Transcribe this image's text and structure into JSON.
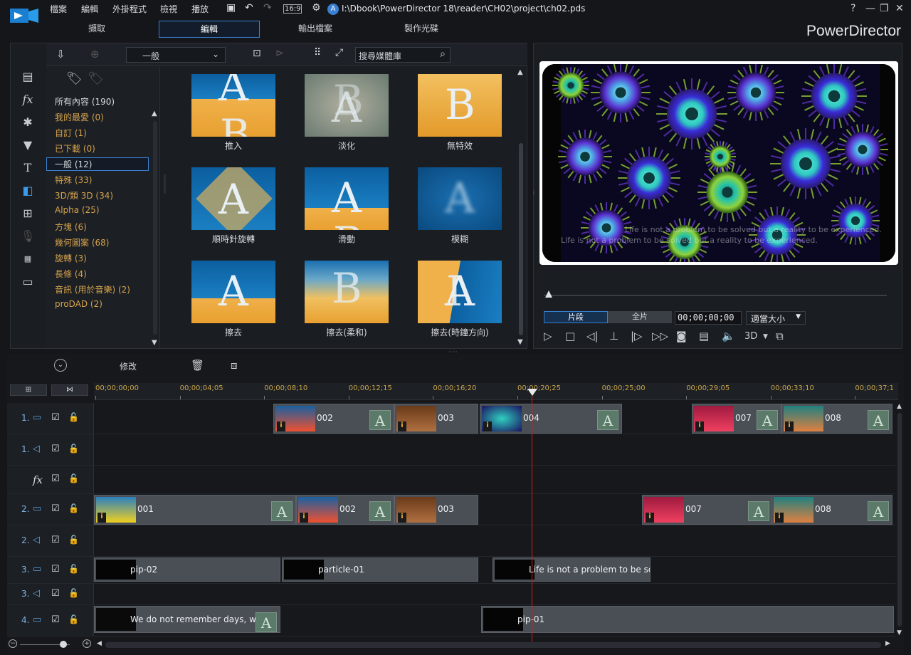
{
  "menu": [
    "檔案",
    "編輯",
    "外掛程式",
    "檢視",
    "播放"
  ],
  "aspect": "16:9",
  "file_path": "I:\\Dbook\\PowerDirector 18\\reader\\CH02\\project\\ch02.pds",
  "window_controls": {
    "help": "?"
  },
  "modes": [
    "擷取",
    "編輯",
    "輸出檔案",
    "製作光碟"
  ],
  "brand": "PowerDirector",
  "library": {
    "dropdown": "一般",
    "search_placeholder": "搜尋媒體庫",
    "categories": [
      {
        "label": "所有內容 (190)",
        "color": "white"
      },
      {
        "label": "我的最愛 (0)"
      },
      {
        "label": "自訂 (1)"
      },
      {
        "label": "已下載 (0)"
      },
      {
        "label": "一般 (12)",
        "selected": true
      },
      {
        "label": "特殊 (33)"
      },
      {
        "label": "3D/類 3D (34)"
      },
      {
        "label": "Alpha (25)"
      },
      {
        "label": "方塊 (6)"
      },
      {
        "label": "幾何圖案 (68)"
      },
      {
        "label": "旋轉 (3)"
      },
      {
        "label": "長條 (4)"
      },
      {
        "label": "音訊 (用於音樂) (2)"
      },
      {
        "label": "proDAD (2)"
      }
    ],
    "transitions": [
      "推入",
      "淡化",
      "無特效",
      "順時針旋轉",
      "滑動",
      "模糊",
      "擦去",
      "擦去(柔和)",
      "擦去(時鐘方向)"
    ]
  },
  "preview": {
    "subtitle_1": "Life is not a problem to be solved but a reality to be experienced.",
    "subtitle_2": "Life is not a problem to be solved but a reality to be experienced.",
    "tab_clip": "片段",
    "tab_movie": "全片",
    "timecode": "00;00;00;00",
    "fit": "適當大小",
    "mode_3d": "3D"
  },
  "timeline": {
    "modify_label": "修改",
    "ticks": [
      "00;00;00;00",
      "00;00;04;05",
      "00;00;08;10",
      "00;00;12;15",
      "00;00;16;20",
      "00;00;20;25",
      "00;00;25;00",
      "00;00;29;05",
      "00;00;33;10",
      "00;00;37;1"
    ],
    "tracks": [
      {
        "num": "1."
      },
      {
        "num": "1."
      },
      {
        "num": ""
      },
      {
        "num": "2."
      },
      {
        "num": "2."
      },
      {
        "num": "3."
      },
      {
        "num": "3."
      },
      {
        "num": "4."
      }
    ],
    "clips": {
      "t1": [
        "002",
        "003",
        "004",
        "007",
        "008"
      ],
      "t2": [
        "001",
        "002",
        "003",
        "007",
        "008"
      ],
      "t3": [
        "pip-02",
        "particle-01",
        "Life is not a problem to be solv"
      ],
      "t4": [
        "We do not remember days, we re",
        "pip-01"
      ]
    }
  }
}
